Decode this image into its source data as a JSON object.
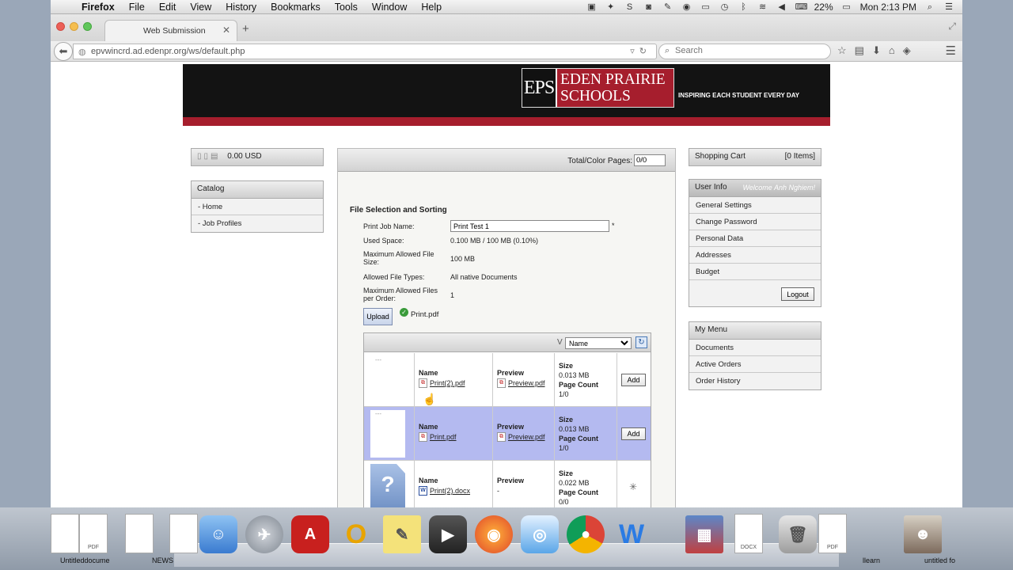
{
  "menubar": {
    "app": "Firefox",
    "items": [
      "File",
      "Edit",
      "View",
      "History",
      "Bookmarks",
      "Tools",
      "Window",
      "Help"
    ],
    "battery": "22%",
    "clock": "Mon 2:13 PM"
  },
  "browser": {
    "tab_title": "Web Submission",
    "url": "epvwincrd.ad.edenpr.org/ws/default.php",
    "search_placeholder": "Search"
  },
  "header": {
    "logo_initials": "EPS",
    "logo_name_line1": "EDEN PRAIRIE",
    "logo_name_line2": "SCHOOLS",
    "tagline": "INSPIRING EACH STUDENT EVERY DAY"
  },
  "left": {
    "balance": "0.00 USD",
    "catalog_title": "Catalog",
    "catalog_items": [
      "- Home",
      "- Job Profiles"
    ]
  },
  "main": {
    "total_pages_label": "Total/Color Pages:",
    "total_pages_value": "0/0",
    "section_title": "File Selection and Sorting",
    "fields": {
      "job_name_label": "Print Job Name:",
      "job_name_value": "Print Test 1",
      "used_space_label": "Used Space:",
      "used_space_value": "0.100 MB / 100 MB (0.10%)",
      "max_size_label_1": "Maximum Allowed File",
      "max_size_label_2": "Size:",
      "max_size_value": "100 MB",
      "types_label": "Allowed File Types:",
      "types_value": "All native Documents",
      "max_files_label_1": "Maximum Allowed Files",
      "max_files_label_2": "per Order:",
      "max_files_value": "1"
    },
    "upload_label": "Upload",
    "uploaded_file": "Print.pdf",
    "sort_selected": "Name",
    "files": [
      {
        "name_label": "Name",
        "name": "Print(2).pdf",
        "preview_label": "Preview",
        "preview": "Preview.pdf",
        "size_label": "Size",
        "size": "0.013 MB",
        "pages_label": "Page Count",
        "pages": "1/0",
        "action": "Add"
      },
      {
        "name_label": "Name",
        "name": "Print.pdf",
        "preview_label": "Preview",
        "preview": "Preview.pdf",
        "size_label": "Size",
        "size": "0.013 MB",
        "pages_label": "Page Count",
        "pages": "1/0",
        "action": "Add"
      },
      {
        "name_label": "Name",
        "name": "Print(2).docx",
        "preview_label": "Preview",
        "preview": "-",
        "size_label": "Size",
        "size": "0.022 MB",
        "pages_label": "Page Count",
        "pages": "0/0"
      }
    ]
  },
  "right": {
    "cart_label": "Shopping Cart",
    "cart_count": "[0 Items]",
    "userinfo_title": "User Info",
    "welcome": "Welcome Anh Nghiem!",
    "userinfo_items": [
      "General Settings",
      "Change Password",
      "Personal Data",
      "Addresses",
      "Budget"
    ],
    "logout_label": "Logout",
    "mymenu_title": "My Menu",
    "mymenu_items": [
      "Documents",
      "Active Orders",
      "Order History"
    ]
  },
  "dock": {
    "labels": [
      "Untitleddocume",
      "NEWS",
      "llearn",
      "untitled fo"
    ]
  }
}
